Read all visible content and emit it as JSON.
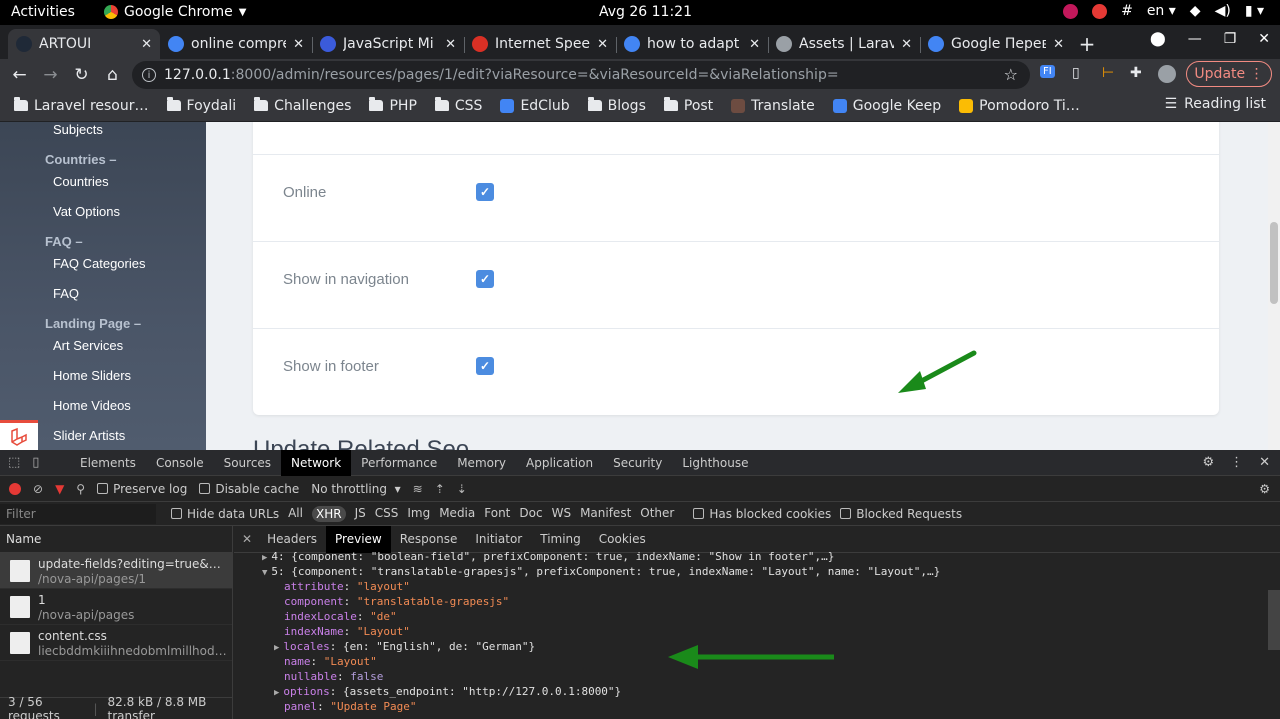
{
  "os": {
    "activities": "Activities",
    "app_name": "Google Chrome",
    "clock": "Avg 26  11:21",
    "keyboard": "en"
  },
  "browser": {
    "tabs": [
      {
        "title": "ARTOUI",
        "active": true,
        "favicon_color": "#1f2937"
      },
      {
        "title": "online compre",
        "active": false,
        "favicon_color": "#4285f4"
      },
      {
        "title": "JavaScript Mi",
        "active": false,
        "favicon_color": "#3b5bdb"
      },
      {
        "title": "Internet Spee",
        "active": false,
        "favicon_color": "#d93025"
      },
      {
        "title": "how to adapt j",
        "active": false,
        "favicon_color": "#4285f4"
      },
      {
        "title": "Assets | Larav",
        "active": false,
        "favicon_color": "#9aa0a6"
      },
      {
        "title": "Google Перев",
        "active": false,
        "favicon_color": "#4285f4"
      }
    ],
    "url_host": "127.0.0.1",
    "url_rest": ":8000/admin/resources/pages/1/edit?viaResource=&viaResourceId=&viaRelationship=",
    "update_label": "Update",
    "bookmarks": [
      {
        "label": "Laravel resour…",
        "type": "folder"
      },
      {
        "label": "Foydali",
        "type": "folder"
      },
      {
        "label": "Challenges",
        "type": "folder"
      },
      {
        "label": "PHP",
        "type": "folder"
      },
      {
        "label": "CSS",
        "type": "folder"
      },
      {
        "label": "EdClub",
        "type": "site"
      },
      {
        "label": "Blogs",
        "type": "folder"
      },
      {
        "label": "Post",
        "type": "folder"
      },
      {
        "label": "Translate",
        "type": "site"
      },
      {
        "label": "Google Keep",
        "type": "site"
      },
      {
        "label": "Pomodoro Ti…",
        "type": "site"
      }
    ],
    "reading_list": "Reading list"
  },
  "sidebar": {
    "entries": [
      {
        "kind": "item",
        "label": "Subjects"
      },
      {
        "kind": "group",
        "label": "Countries –"
      },
      {
        "kind": "item",
        "label": "Countries"
      },
      {
        "kind": "item",
        "label": "Vat Options"
      },
      {
        "kind": "group",
        "label": "FAQ –"
      },
      {
        "kind": "item",
        "label": "FAQ Categories"
      },
      {
        "kind": "item",
        "label": "FAQ"
      },
      {
        "kind": "group",
        "label": "Landing Page –"
      },
      {
        "kind": "item",
        "label": "Art Services"
      },
      {
        "kind": "item",
        "label": "Home Sliders"
      },
      {
        "kind": "item",
        "label": "Home Videos"
      },
      {
        "kind": "item",
        "label": "Slider Artists"
      }
    ]
  },
  "form": {
    "fields": [
      {
        "label": "Online",
        "checked": true
      },
      {
        "label": "Show in navigation",
        "checked": true
      },
      {
        "label": "Show in footer",
        "checked": true
      }
    ],
    "related_heading": "Update Related Seo"
  },
  "devtools": {
    "tabs": [
      "Elements",
      "Console",
      "Sources",
      "Network",
      "Performance",
      "Memory",
      "Application",
      "Security",
      "Lighthouse"
    ],
    "active_tab": "Network",
    "toolbar": {
      "preserve_log": "Preserve log",
      "disable_cache": "Disable cache",
      "throttling": "No throttling"
    },
    "filter": {
      "placeholder": "Filter",
      "hide_data_urls": "Hide data URLs",
      "types": [
        "All",
        "XHR",
        "JS",
        "CSS",
        "Img",
        "Media",
        "Font",
        "Doc",
        "WS",
        "Manifest",
        "Other"
      ],
      "active_type": "XHR",
      "has_blocked_cookies": "Has blocked cookies",
      "blocked_requests": "Blocked Requests"
    },
    "requests_header": "Name",
    "requests": [
      {
        "name": "update-fields?editing=true&editM…",
        "path": "/nova-api/pages/1",
        "selected": true
      },
      {
        "name": "1",
        "path": "/nova-api/pages",
        "selected": false
      },
      {
        "name": "content.css",
        "path": "liecbddmkiiihnedobmlmillhodjkdm…",
        "selected": false
      }
    ],
    "status_requests": "3 / 56 requests",
    "status_transfer": "82.8 kB / 8.8 MB transfer",
    "detail_tabs": [
      "Headers",
      "Preview",
      "Response",
      "Initiator",
      "Timing",
      "Cookies"
    ],
    "active_detail_tab": "Preview",
    "preview_lines": [
      {
        "indent": 0,
        "arrow": "▶",
        "text": "4: {component: \"boolean-field\", prefixComponent: true, indexName: \"Show in footer\",…}"
      },
      {
        "indent": 0,
        "arrow": "▼",
        "text": "5: {component: \"translatable-grapesjs\", prefixComponent: true, indexName: \"Layout\", name: \"Layout\",…}"
      },
      {
        "indent": 1,
        "key": "attribute",
        "value": "\"layout\"",
        "vtype": "str"
      },
      {
        "indent": 1,
        "key": "component",
        "value": "\"translatable-grapesjs\"",
        "vtype": "str"
      },
      {
        "indent": 1,
        "key": "indexLocale",
        "value": "\"de\"",
        "vtype": "str"
      },
      {
        "indent": 1,
        "key": "indexName",
        "value": "\"Layout\"",
        "vtype": "str"
      },
      {
        "indent": 1,
        "arrow": "▶",
        "key": "locales",
        "value": "{en: \"English\", de: \"German\"}",
        "vtype": "obj"
      },
      {
        "indent": 1,
        "key": "name",
        "value": "\"Layout\"",
        "vtype": "str"
      },
      {
        "indent": 1,
        "key": "nullable",
        "value": "false",
        "vtype": "kw"
      },
      {
        "indent": 1,
        "arrow": "▶",
        "key": "options",
        "value": "{assets_endpoint: \"http://127.0.0.1:8000\"}",
        "vtype": "obj"
      },
      {
        "indent": 1,
        "key": "panel",
        "value": "\"Update Page\"",
        "vtype": "str"
      }
    ]
  },
  "colors": {
    "annotation_arrow": "#1a8a1a",
    "checkbox": "#4c8ce0"
  }
}
